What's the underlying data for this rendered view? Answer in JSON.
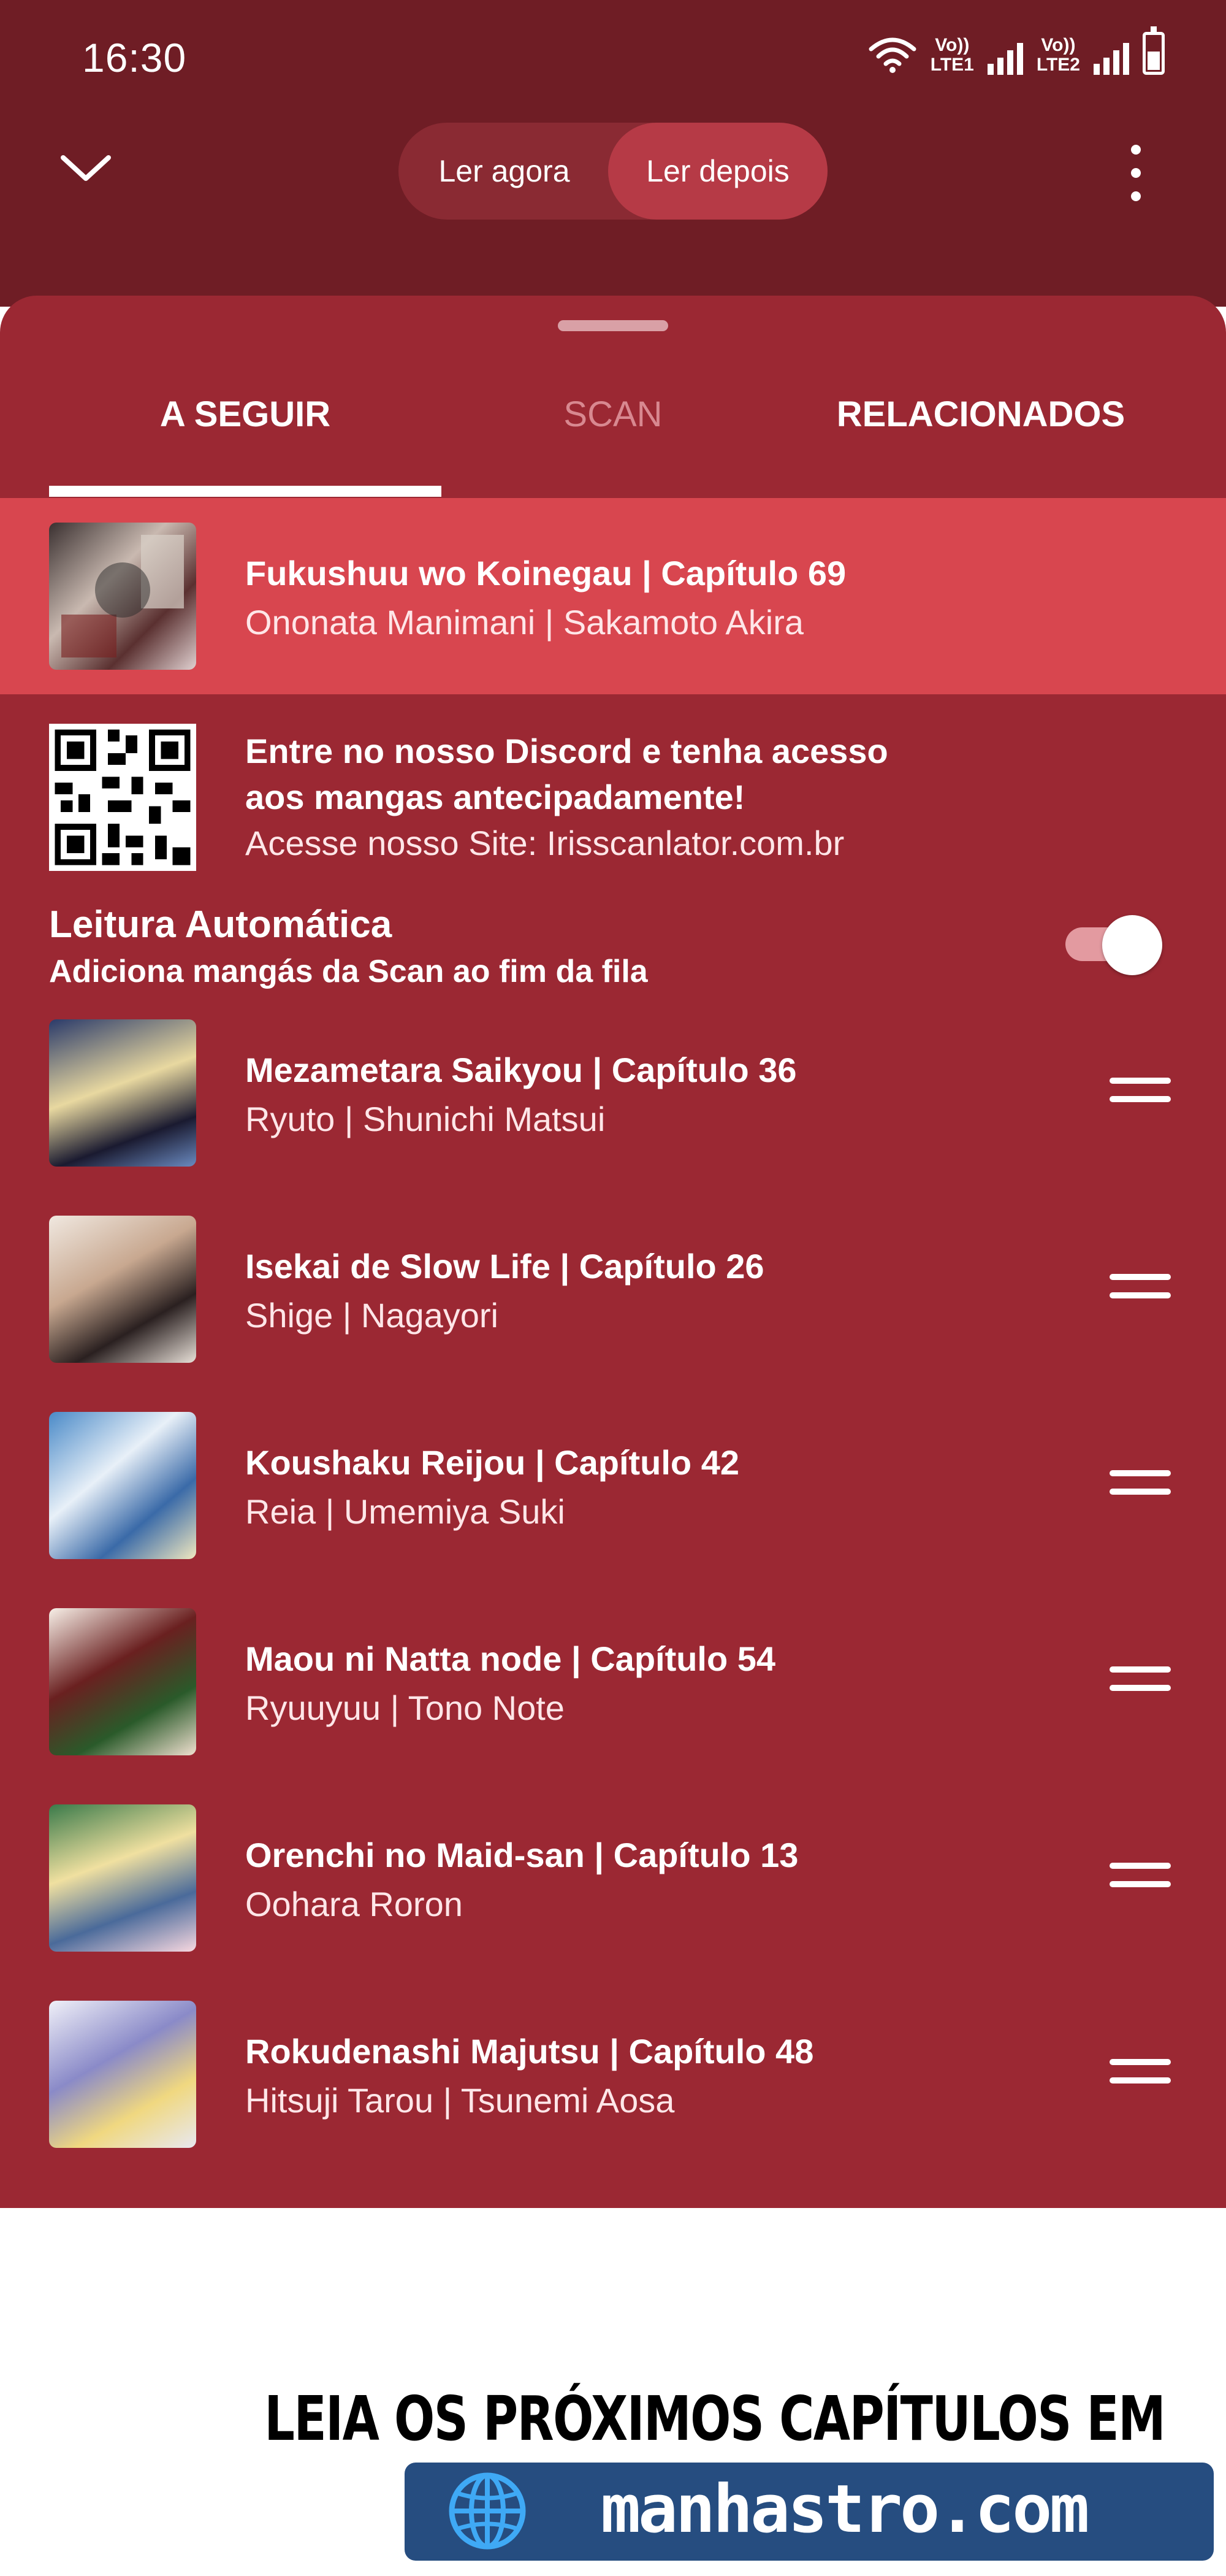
{
  "status_bar": {
    "time": "16:30",
    "sim1_label": "Vo))",
    "sim1_net": "LTE1",
    "sim2_label": "Vo))",
    "sim2_net": "LTE2"
  },
  "header": {
    "segments": [
      "Ler agora",
      "Ler depois"
    ],
    "active_segment": "Ler depois"
  },
  "tabs": [
    {
      "label": "A SEGUIR",
      "active": true
    },
    {
      "label": "SCAN",
      "active": false
    },
    {
      "label": "RELACIONADOS",
      "active": false
    }
  ],
  "current": {
    "title": "Fukushuu wo Koinegau | Capítulo 69",
    "subtitle": "Ononata Manimani | Sakamoto Akira"
  },
  "promo": {
    "line1": "Entre no nosso Discord e tenha acesso",
    "line2": "aos mangas antecipadamente!",
    "line3": "Acesse nosso Site: Irisscanlator.com.br"
  },
  "autoplay": {
    "title": "Leitura Automática",
    "subtitle": "Adiciona mangás da Scan ao fim da fila",
    "enabled": true
  },
  "queue": [
    {
      "title": "Mezametara Saikyou | Capítulo 36",
      "subtitle": "Ryuto | Shunichi Matsui"
    },
    {
      "title": "Isekai de Slow Life | Capítulo 26",
      "subtitle": "Shige | Nagayori"
    },
    {
      "title": "Koushaku Reijou | Capítulo 42",
      "subtitle": "Reia | Umemiya Suki"
    },
    {
      "title": "Maou ni Natta node | Capítulo 54",
      "subtitle": "Ryuuyuu | Tono Note"
    },
    {
      "title": "Orenchi no Maid-san | Capítulo 13",
      "subtitle": "Oohara Roron"
    },
    {
      "title": "Rokudenashi Majutsu | Capítulo 48",
      "subtitle": "Hitsuji Tarou | Tsunemi Aosa"
    }
  ],
  "footer": {
    "banner_text": "LEIA OS PRÓXIMOS CAPÍTULOS EM",
    "domain": "manhastro.com"
  },
  "colors": {
    "header_bg": "#6f1d25",
    "sheet_bg": "#9b2833",
    "current_row": "#d8464f",
    "banner_bg": "#264d80"
  }
}
